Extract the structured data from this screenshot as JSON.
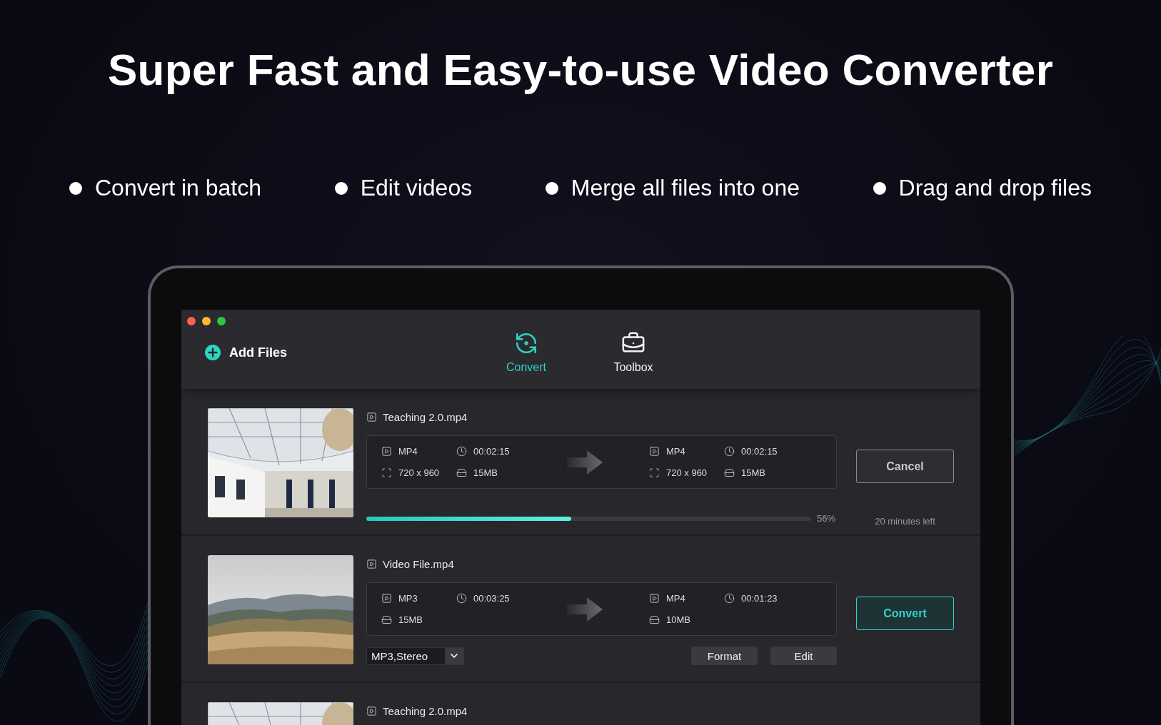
{
  "headline": "Super Fast and Easy-to-use Video Converter",
  "features": [
    "Convert in batch",
    "Edit videos",
    "Merge all files into one",
    "Drag and drop files"
  ],
  "app": {
    "add_files": "Add Files",
    "tabs": [
      {
        "label": "Convert",
        "selected": true
      },
      {
        "label": "Toolbox",
        "selected": false
      }
    ],
    "files": [
      {
        "name": "Teaching 2.0.mp4",
        "thumbnail": {
          "kind": "picture"
        },
        "source": {
          "format": "MP4",
          "duration": "00:02:15",
          "resolution": "720 x 960",
          "size": "15MB"
        },
        "target": {
          "format": "MP4",
          "duration": "00:02:15",
          "resolution": "720 x 960",
          "size": "15MB"
        },
        "action": {
          "label": "Cancel",
          "kind": "cancel"
        },
        "progress": {
          "level": 0.46,
          "percent": "56%",
          "remaining": "20 minutes left"
        }
      },
      {
        "name": "Video File.mp4",
        "thumbnail": {
          "kind": "picture"
        },
        "source": {
          "format": "MP3",
          "duration": "00:03:25",
          "size": "15MB"
        },
        "target": {
          "format": "MP4",
          "duration": "00:01:23",
          "size": "10MB"
        },
        "action": {
          "label": "Convert",
          "kind": "convert"
        },
        "audio_option": "MP3,Stereo",
        "buttons": [
          "Format",
          "Edit"
        ]
      },
      {
        "name": "Teaching 2.0.mp4",
        "thumbnail": {
          "kind": "picture"
        }
      }
    ]
  }
}
